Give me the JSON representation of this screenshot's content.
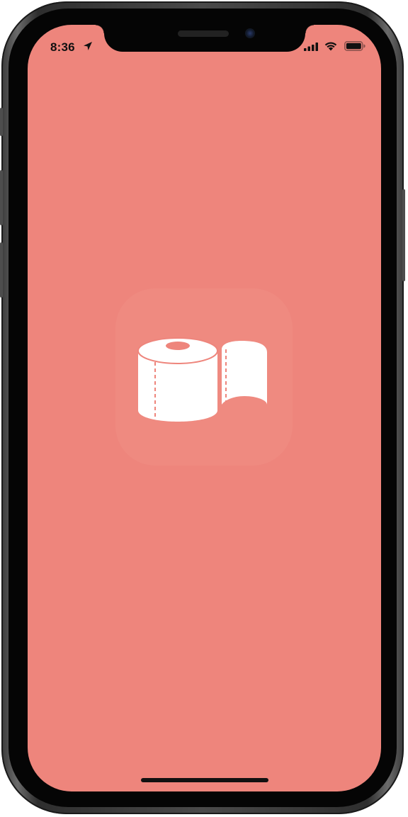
{
  "status_bar": {
    "time": "8:36",
    "location_icon": "location-arrow-icon",
    "signal_icon": "cellular-signal-icon",
    "wifi_icon": "wifi-icon",
    "battery_icon": "battery-icon"
  },
  "splash": {
    "icon": "toilet-paper-roll-icon",
    "background_color": "#ee857c",
    "icon_color": "#ffffff"
  },
  "device": {
    "frame_color": "#3a3a3a"
  }
}
